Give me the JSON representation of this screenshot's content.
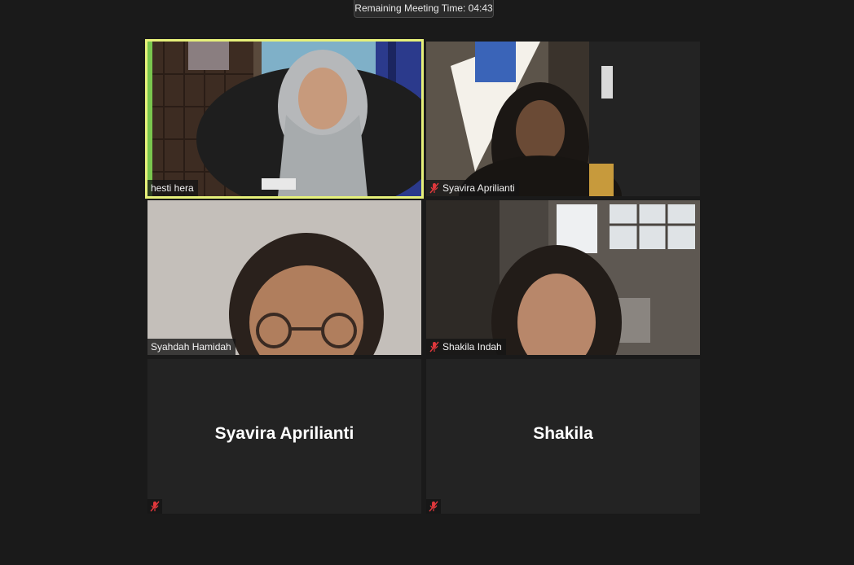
{
  "meeting": {
    "remaining_label": "Remaining Meeting Time: 04:43"
  },
  "tiles": [
    {
      "name": "hesti hera",
      "muted": false,
      "active": true,
      "video": true
    },
    {
      "name": "Syavira Aprilianti",
      "muted": true,
      "active": false,
      "video": true
    },
    {
      "name": "Syahdah Hamidah",
      "muted": false,
      "active": false,
      "video": true
    },
    {
      "name": "Shakila Indah",
      "muted": true,
      "active": false,
      "video": true
    },
    {
      "name": "Syavira Aprilianti",
      "muted": true,
      "active": false,
      "video": false
    },
    {
      "name": "Shakila",
      "muted": true,
      "active": false,
      "video": false
    }
  ],
  "colors": {
    "active_border": "#e6f07a",
    "muted_icon": "#e0383c",
    "background": "#1a1a1a",
    "tile_bg": "#232323"
  },
  "icons": {
    "muted": "mic-muted-icon"
  }
}
